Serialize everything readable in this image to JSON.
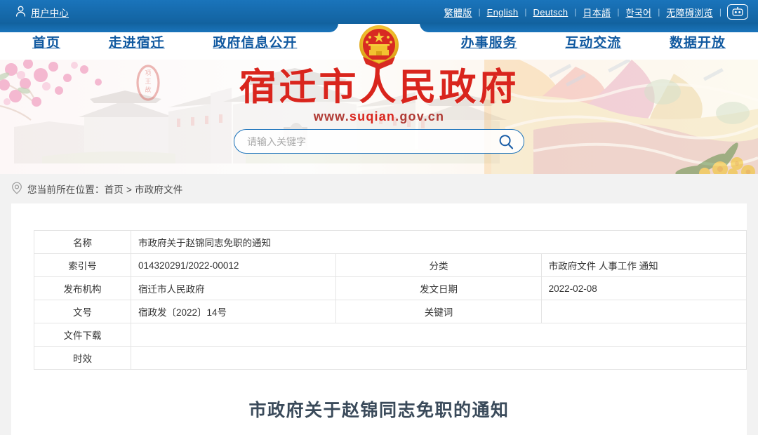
{
  "topbar": {
    "user_center": "用户中心",
    "user_icon": "user-icon",
    "languages": [
      "繁體版",
      "English",
      "Deutsch",
      "日本語",
      "한국어",
      "无障碍浏览"
    ],
    "separator": "|",
    "assistant_icon": "robot-icon"
  },
  "nav": {
    "emblem_icon": "china-national-emblem",
    "items": [
      "首页",
      "走进宿迁",
      "政府信息公开",
      "办事服务",
      "互动交流",
      "数据开放"
    ]
  },
  "banner": {
    "title": "宿迁市人民政府",
    "url_prefix": "www.",
    "url_main": "suqian",
    "url_suffix": ".gov.cn",
    "url_full": "www.suqian.gov.cn",
    "search": {
      "placeholder": "请输入关键字",
      "value": "",
      "button_icon": "search-icon"
    },
    "artwork": {
      "left_scene": "项王故里城楼水彩插画",
      "seal_text": "项王故里",
      "right_scene": "彩色山水水彩插画"
    }
  },
  "breadcrumb": {
    "icon": "location-pin-icon",
    "prefix": "您当前所在位置：",
    "items": [
      "首页",
      "市政府文件"
    ],
    "separator": ">",
    "full_text": "您当前所在位置：首页 > 市政府文件"
  },
  "meta_table": {
    "rows": [
      {
        "label": "名称",
        "value": "市政府关于赵锦同志免职的通知",
        "label2": "",
        "value2": "",
        "span": true
      },
      {
        "label": "索引号",
        "value": "014320291/2022-00012",
        "label2": "分类",
        "value2": "市政府文件  人事工作   通知",
        "span": false
      },
      {
        "label": "发布机构",
        "value": "宿迁市人民政府",
        "label2": "发文日期",
        "value2": "2022-02-08",
        "span": false
      },
      {
        "label": "文号",
        "value": "宿政发〔2022〕14号",
        "label2": "关键词",
        "value2": "",
        "span": false
      },
      {
        "label": "文件下载",
        "value": "",
        "label2": "",
        "value2": "",
        "span": true
      },
      {
        "label": "时效",
        "value": "",
        "label2": "",
        "value2": "",
        "span": true
      }
    ]
  },
  "document": {
    "title": "市政府关于赵锦同志免职的通知"
  },
  "colors": {
    "header_blue": "#12629f",
    "nav_blue": "#1059a0",
    "brand_red": "#d9251d",
    "page_bg": "#f2f2f2",
    "border_gray": "#e4e4e4",
    "doc_title": "#3a4a5a"
  }
}
